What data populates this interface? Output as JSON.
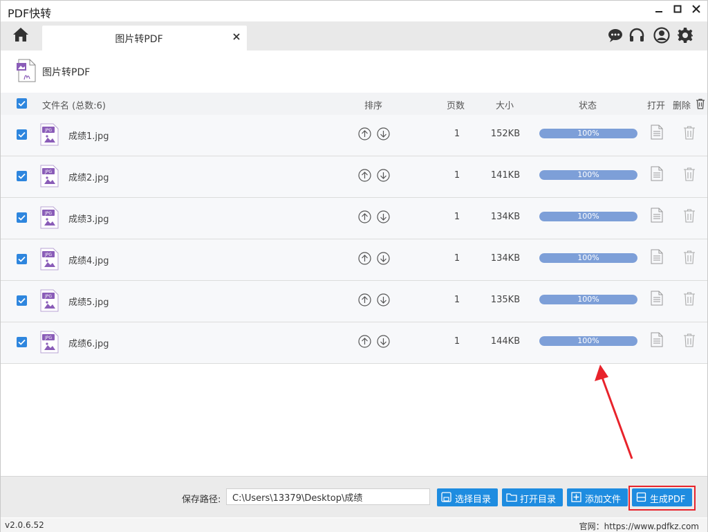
{
  "app": {
    "title": "PDF快转",
    "minimize": "▬",
    "maximize": "□",
    "close": "✕"
  },
  "tab": {
    "label": "图片转PDF",
    "close": "✕"
  },
  "header_icons": [
    "chat-icon",
    "headset-icon",
    "user-icon",
    "gear-icon"
  ],
  "page": {
    "heading": "图片转PDF"
  },
  "table": {
    "headers": {
      "filename": "文件名 (总数:6)",
      "sort": "排序",
      "pages": "页数",
      "size": "大小",
      "status": "状态",
      "open": "打开",
      "delete": "删除"
    },
    "rows": [
      {
        "name": "成绩1.jpg",
        "pages": "1",
        "size": "152KB",
        "status": "100%",
        "progress": 1.0
      },
      {
        "name": "成绩2.jpg",
        "pages": "1",
        "size": "141KB",
        "status": "100%",
        "progress": 1.0
      },
      {
        "name": "成绩3.jpg",
        "pages": "1",
        "size": "134KB",
        "status": "100%",
        "progress": 1.0
      },
      {
        "name": "成绩4.jpg",
        "pages": "1",
        "size": "134KB",
        "status": "100%",
        "progress": 1.0
      },
      {
        "name": "成绩5.jpg",
        "pages": "1",
        "size": "135KB",
        "status": "100%",
        "progress": 1.0
      },
      {
        "name": "成绩6.jpg",
        "pages": "1",
        "size": "144KB",
        "status": "100%",
        "progress": 1.0
      }
    ]
  },
  "footer": {
    "save_path_label": "保存路径:",
    "save_path_value": "C:\\Users\\13379\\Desktop\\成绩",
    "buttons": {
      "select_dir": "选择目录",
      "open_dir": "打开目录",
      "add_file": "添加文件",
      "generate_pdf": "生成PDF"
    }
  },
  "status_bar": {
    "version": "v2.0.6.52",
    "website": "官网：https://www.pdfkz.com"
  },
  "colors": {
    "accent": "#1e8ce0",
    "checkbox": "#2e86de",
    "progress": "#7d9fd8",
    "highlight": "#e8232b",
    "file_icon": "#8a5cb8"
  }
}
